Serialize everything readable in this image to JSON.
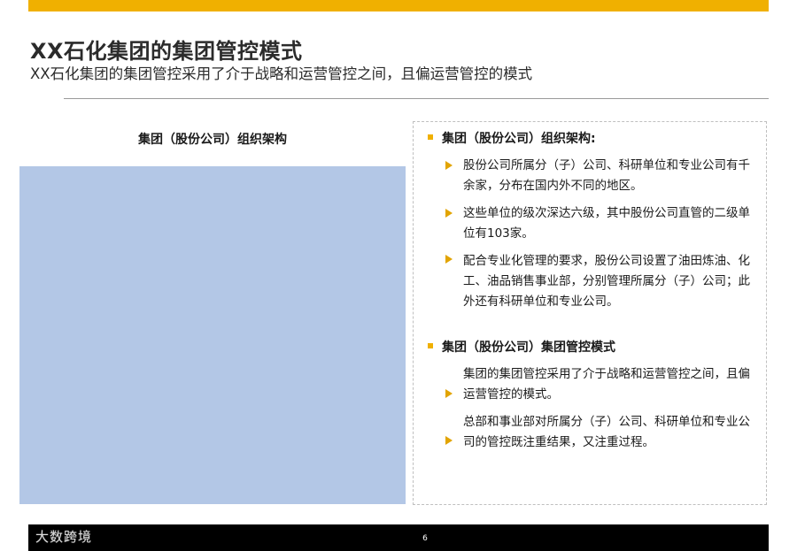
{
  "header": {
    "title": "XX石化集团的集团管控模式",
    "subtitle": "XX石化集团的集团管控采用了介于战略和运营管控之间，且偏运营管控的模式"
  },
  "left_panel": {
    "heading": "集团（股份公司）组织架构"
  },
  "right_panel": {
    "sections": [
      {
        "heading": "集团（股份公司）组织架构:",
        "items": [
          "股份公司所属分（子）公司、科研单位和专业公司有千余家，分布在国内外不同的地区。",
          "这些单位的级次深达六级，其中股份公司直管的二级单位有103家。",
          "配合专业化管理的要求，股份公司设置了油田炼油、化工、油品销售事业部，分别管理所属分（子）公司；此外还有科研单位和专业公司。"
        ]
      },
      {
        "heading": "集团（股份公司）集团管控模式",
        "items": [
          "集团的集团管控采用了介于战略和运营管控之间，且偏运营管控的模式。",
          "总部和事业部对所属分（子）公司、科研单位和专业公司的管控既注重结果，又注重过程。"
        ]
      }
    ]
  },
  "footer": {
    "page_number": "6",
    "watermark": "大数跨境"
  },
  "colors": {
    "accent": "#f0b000",
    "arrow": "#e2a400",
    "chart_fill": "#b3c7e6",
    "footer_bar": "#000000"
  }
}
